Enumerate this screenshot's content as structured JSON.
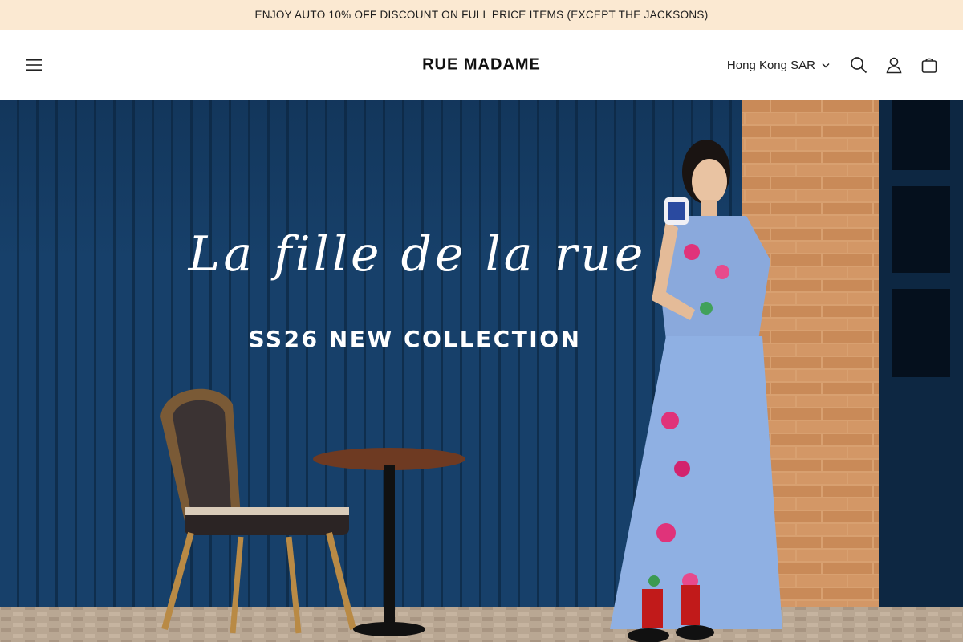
{
  "announcement": {
    "text": "ENJOY AUTO 10% OFF DISCOUNT ON FULL PRICE ITEMS (EXCEPT THE JACKSONS)"
  },
  "header": {
    "logo": "RUE MADAME",
    "country_selector": {
      "selected": "Hong Kong SAR"
    },
    "icons": [
      "menu-icon",
      "chevron-down-icon",
      "search-icon",
      "account-icon",
      "cart-icon"
    ]
  },
  "hero": {
    "script_title": "La fille de la rue",
    "subtitle": "SS26 NEW COLLECTION"
  },
  "colors": {
    "announcement_bg": "#fbe9d2",
    "hero_door": "#173e62",
    "brick": "#c8895a"
  }
}
